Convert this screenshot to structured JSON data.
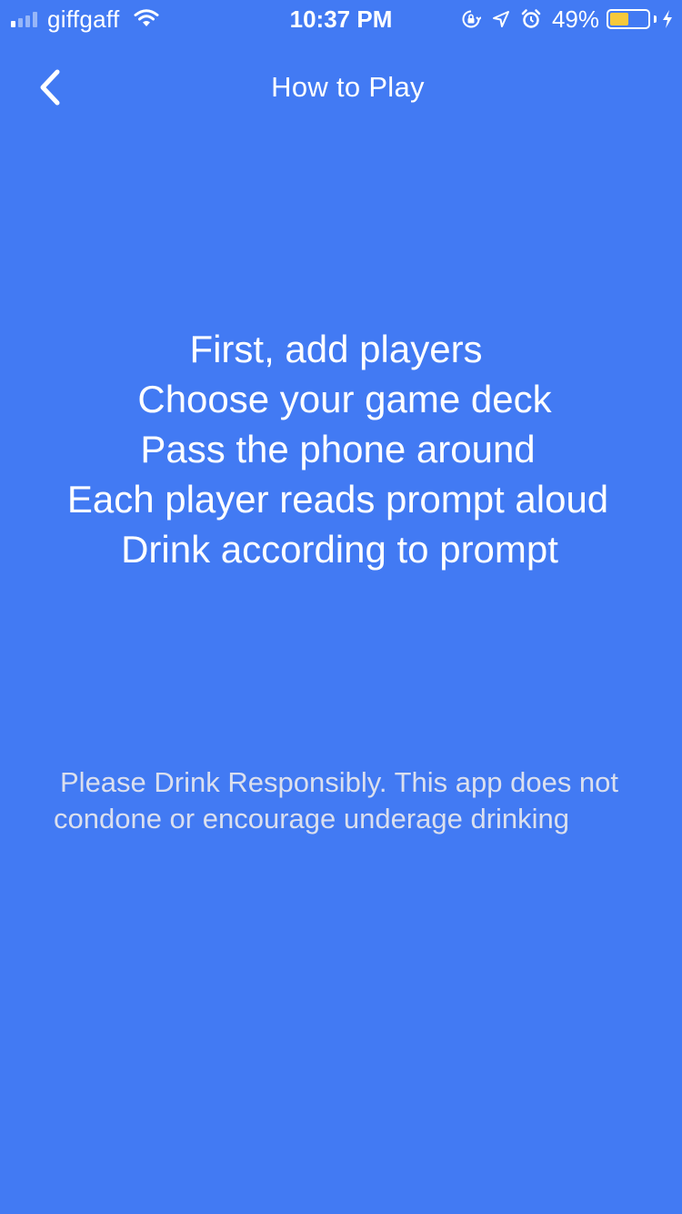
{
  "status_bar": {
    "carrier": "giffgaff",
    "time": "10:37 PM",
    "battery_percent": "49%",
    "battery_level": 0.49,
    "battery_fill_color": "#F6C93B",
    "icons": [
      "signal-icon",
      "wifi-icon",
      "orientation-lock-icon",
      "location-icon",
      "alarm-icon",
      "battery-icon",
      "charging-icon"
    ]
  },
  "nav": {
    "back_icon": "chevron-left-icon",
    "title": "How to Play"
  },
  "instructions": [
    "First, add players",
    "Choose your game deck",
    "Pass the phone around",
    "Each player reads prompt aloud",
    "Drink according to prompt"
  ],
  "disclaimer": "Please Drink Responsibly. This app does not condone or encourage underage drinking",
  "colors": {
    "background": "#427AF3",
    "text": "#FFFFFF",
    "disclaimer_text": "#DADFEE"
  }
}
